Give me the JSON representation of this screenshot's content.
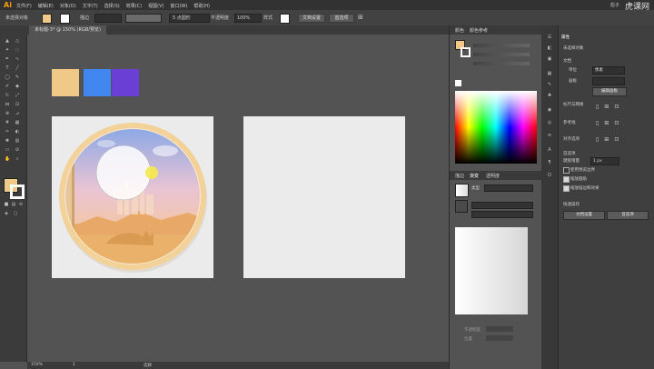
{
  "app": {
    "logo": "Ai"
  },
  "menubar": {
    "items": [
      "文件(F)",
      "编辑(E)",
      "对象(O)",
      "文字(T)",
      "选择(S)",
      "效果(C)",
      "视图(V)",
      "窗口(W)",
      "帮助(H)"
    ],
    "user": "彪子",
    "watermark": "虎课网"
  },
  "control": {
    "selection_label": "未选择对象",
    "stroke_label": "描边",
    "brush_label": "5 点圆形",
    "opacity_label": "不透明度",
    "opacity_value": "100%",
    "style_label": "样式",
    "doc_setup": "文档设置",
    "prefs": "首选项"
  },
  "document": {
    "tab_title": "未标题-3* @ 150% (RGB/预览)"
  },
  "status": {
    "zoom": "150%",
    "page": "1",
    "tool": "选择"
  },
  "artwork": {
    "palette": [
      {
        "name": "sand",
        "color": "#f0c887"
      },
      {
        "name": "blue",
        "color": "#4286ef"
      },
      {
        "name": "purple",
        "color": "#6a3fd6"
      }
    ]
  },
  "mid_panel": {
    "color_tab": "颜色",
    "color_guide_tab": "颜色参考",
    "color_mode_tabs": [
      "描边",
      "渐变",
      "透明度"
    ],
    "gradient_type_label": "类型",
    "opacity_label": "不透明度",
    "position_label": "位置"
  },
  "right_panel": {
    "title": "属性",
    "no_selection": "未选择对象",
    "document_label": "文档",
    "units_label": "单位",
    "units_value": "像素",
    "artboard_label": "画板",
    "edit_artboard_btn": "编辑画板",
    "snap_label": "标尺与网格",
    "guides_label": "参考线",
    "align_label": "对齐选项",
    "prefs_label": "首选项",
    "keyboard_inc_label": "键盘增量",
    "keyboard_inc_value": "1 px",
    "use_preview_bounds": "使用预览边界",
    "scale_corners": "缩放圆角",
    "scale_strokes": "缩放描边和效果",
    "quick_actions": "快速操作",
    "doc_setup_btn": "文档设置",
    "prefs_btn": "首选项"
  }
}
